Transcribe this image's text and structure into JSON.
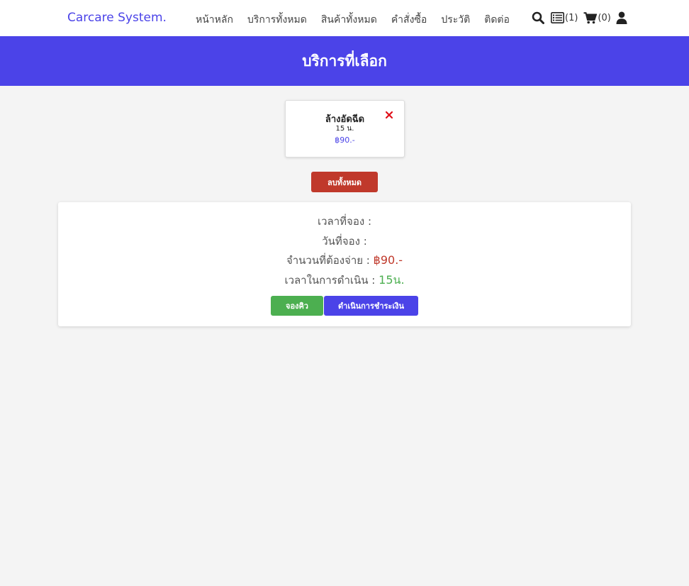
{
  "navbar": {
    "brand": "Carcare System.",
    "links": [
      "หน้าหลัก",
      "บริการทั้งหมด",
      "สินค้าทั้งหมด",
      "คำสั่งซื้อ",
      "ประวัติ",
      "ติดต่อ"
    ],
    "icons": {
      "search": "search-icon",
      "list": "list-icon",
      "cart": "cart-icon",
      "user": "user-icon"
    },
    "list_count": "(1)",
    "cart_count": "(0)"
  },
  "banner": {
    "title": "บริการที่เลือก"
  },
  "selected_service": {
    "name": "ล้างอัดฉีด",
    "duration": "15 น.",
    "price": "฿90.-",
    "remove_icon": "close-icon"
  },
  "clear_all_label": "ลบทั้งหมด",
  "summary": {
    "time_label": "เวลาที่จอง :",
    "date_label": "วันที่จอง :",
    "amount_label": "จำนวนที่ต้องจ่าย :",
    "amount_value": "฿90.-",
    "duration_label": "เวลาในการดำเนิน :",
    "duration_value": "15น.",
    "book_label": "จองคิว",
    "pay_label": "ดำเนินการชำระเงิน"
  },
  "colors": {
    "brand": "#4b43e8",
    "danger": "#c0392b",
    "success": "#4caf50",
    "background": "#f4f4f4"
  }
}
